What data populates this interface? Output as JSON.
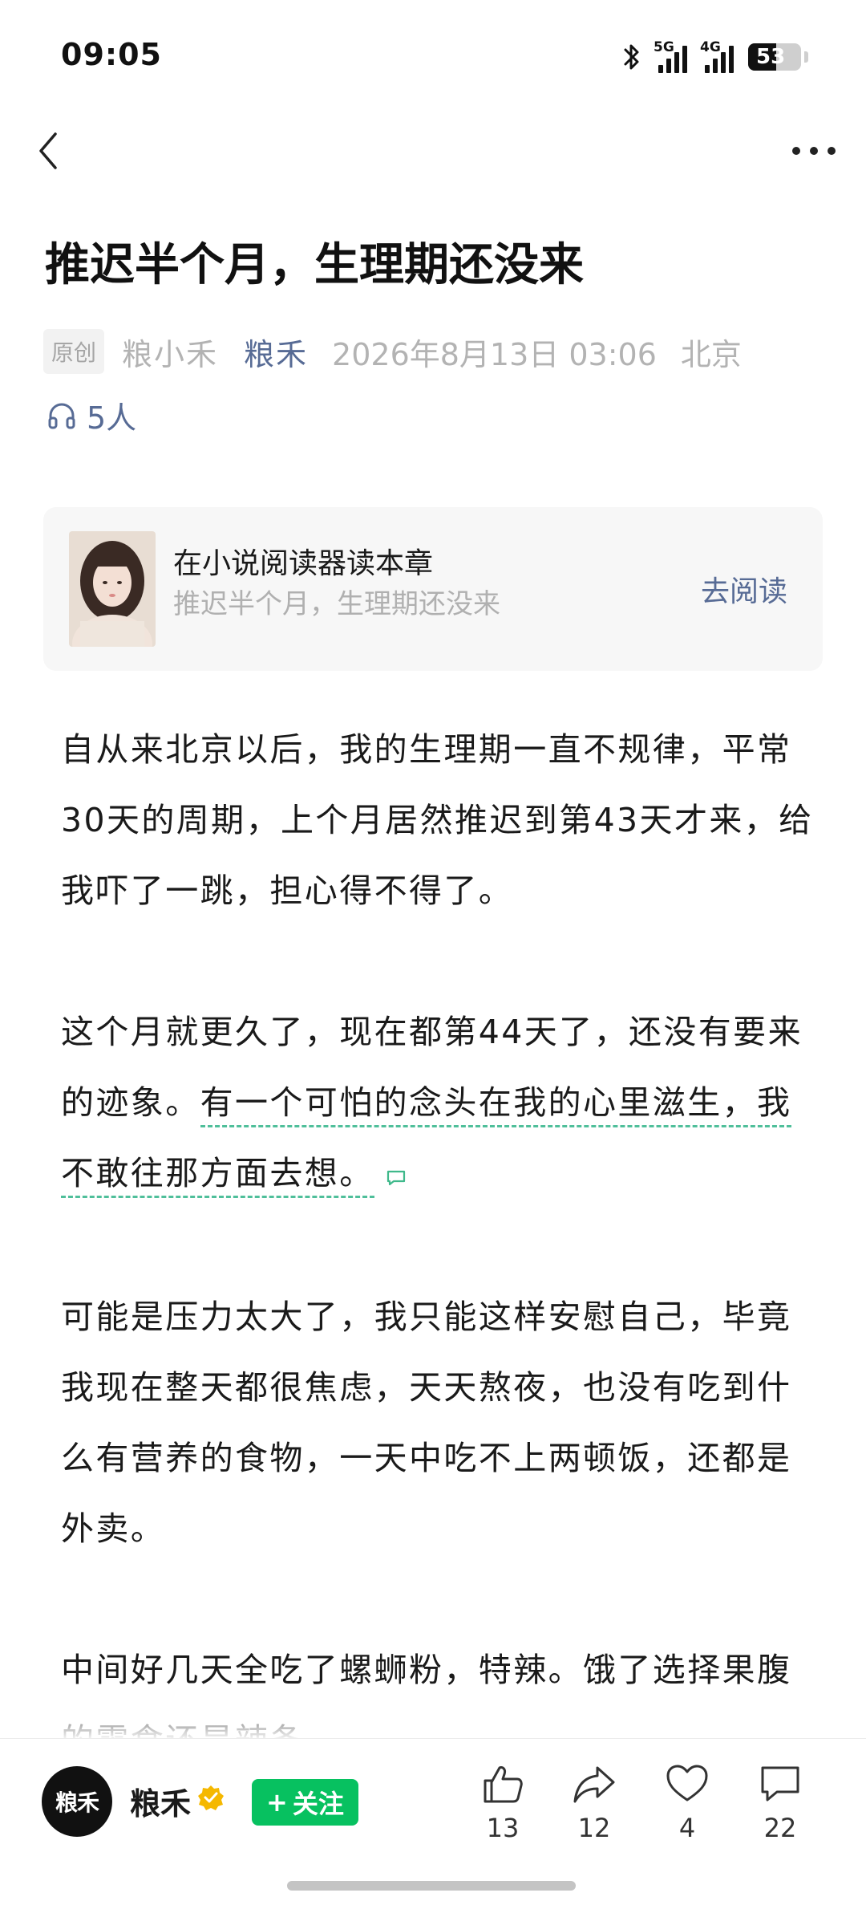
{
  "status_bar": {
    "time": "09:05",
    "signal1_label": "5G",
    "signal2_label": "4G",
    "battery": "53",
    "battery_level": 0.53
  },
  "article": {
    "title": "推迟半个月，生理期还没来",
    "original_badge": "原创",
    "author": "粮小禾",
    "account": "粮禾",
    "date": "2026年8月13日 03:06",
    "location": "北京",
    "listeners": "5人",
    "paragraphs": [
      "自从来北京以后，我的生理期一直不规律，平常30天的周期，上个月居然推迟到第43天才来，给我吓了一跳，担心得不得了。",
      "这个月就更久了，现在都第44天了，还没有要来的迹象。",
      "有一个可怕的念头在我的心里滋生，我不敢往那方面去想。",
      "可能是压力太大了，我只能这样安慰自己，毕竟我现在整天都很焦虑，天天熬夜，也没有吃到什么有营养的食物，一天中吃不上两顿饭，还都是外卖。",
      "中间好几天全吃了螺蛳粉，特辣。饿了选择果腹的零食还是辣条"
    ]
  },
  "reader_card": {
    "line1": "在小说阅读器读本章",
    "line2": "推迟半个月，生理期还没来",
    "button": "去阅读"
  },
  "bottom_bar": {
    "avatar_text": "粮禾",
    "account_name": "粮禾",
    "follow_label": "关注",
    "like_count": "13",
    "share_count": "12",
    "favorite_count": "4",
    "comment_count": "22"
  },
  "colors": {
    "link": "#576b95",
    "follow_green": "#07c160",
    "highlight_dash": "#4fbf9a"
  }
}
